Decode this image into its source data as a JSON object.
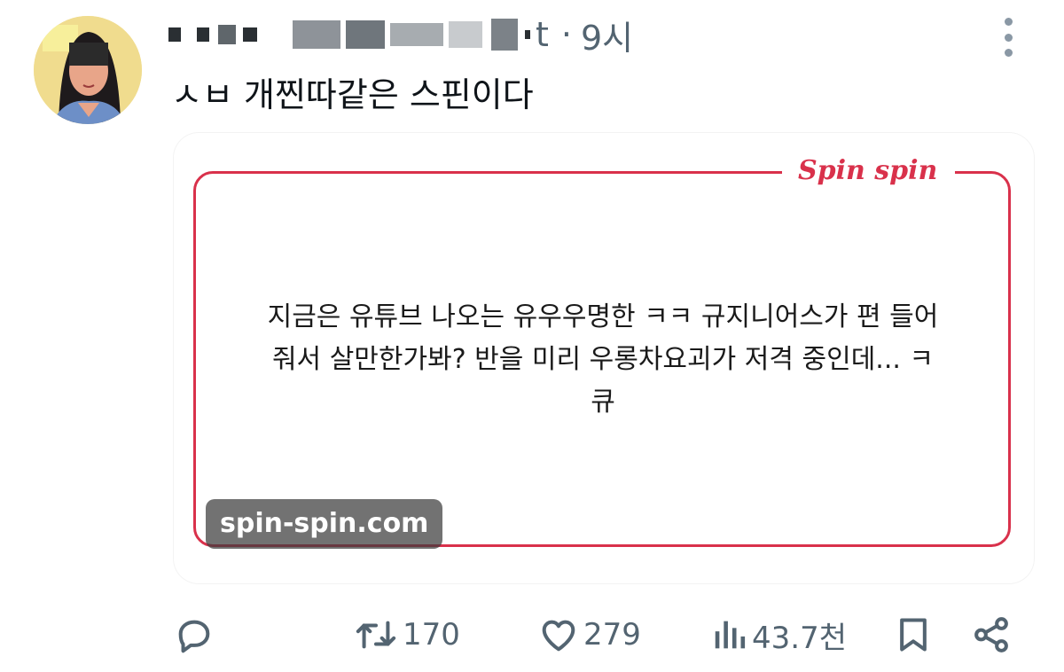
{
  "post": {
    "author_name_tail": "t",
    "separator": "·",
    "time": "9시",
    "text": "ㅅㅂ 개찐따같은 스핀이다"
  },
  "card": {
    "logo": "Spin spin",
    "body_line1": "지금은 유튜브 나오는 유우우명한 ㅋㅋ 규지니어스가 편 들어",
    "body_line2": "줘서 살만한가봐? 반을 미리 우롱차요괴가 저격 중인데... ㅋ",
    "body_line3": "큐",
    "domain": "spin-spin.com",
    "accent_color": "#d9314b"
  },
  "actions": {
    "reply_icon": "reply-icon",
    "retweets": "170",
    "likes": "279",
    "views": "43.7천",
    "bookmark_icon": "bookmark-icon",
    "share_icon": "share-icon"
  },
  "icons": [
    "more-icon",
    "reply-icon",
    "retweet-icon",
    "heart-icon",
    "views-icon",
    "bookmark-icon",
    "share-icon"
  ]
}
